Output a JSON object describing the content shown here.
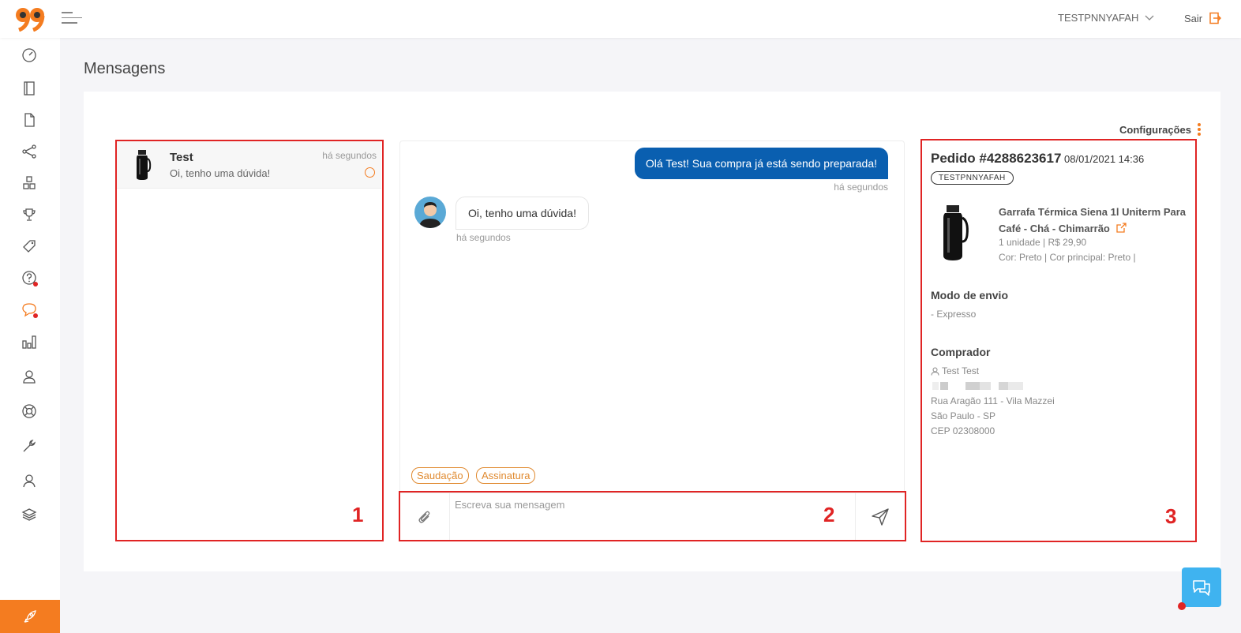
{
  "header": {
    "user_name": "TESTPNNYAFAH",
    "logout_label": "Sair"
  },
  "page": {
    "title": "Mensagens",
    "settings_label": "Configurações"
  },
  "conversations": [
    {
      "name": "Test",
      "last_message": "Oi, tenho uma dúvida!",
      "time": "há segundos"
    }
  ],
  "chat": {
    "outgoing_message": "Olá Test! Sua compra já está sendo preparada!",
    "outgoing_time": "há segundos",
    "incoming_message": "Oi, tenho uma dúvida!",
    "incoming_time": "há segundos",
    "quick_replies": [
      "Saudação",
      "Assinatura"
    ],
    "input_placeholder": "Escreva sua mensagem"
  },
  "order": {
    "title": "Pedido #4288623617",
    "date": "08/01/2021 14:36",
    "seller_badge": "TESTPNNYAFAH",
    "product_name": "Garrafa Térmica Siena 1l Uniterm Para Café - Chá - Chimarrão",
    "product_qty_price": "1 unidade | R$ 29,90",
    "product_attrs": "Cor: Preto | Cor principal: Preto |",
    "shipping_title": "Modo de envio",
    "shipping_value": "- Expresso",
    "buyer_title": "Comprador",
    "buyer_name": "Test Test",
    "buyer_address": "Rua Aragão 111 - Vila Mazzei",
    "buyer_city": "São Paulo - SP",
    "buyer_zip": "CEP 02308000"
  },
  "annotations": [
    "1",
    "2",
    "3"
  ],
  "colors": {
    "accent": "#f47c20",
    "primary_blue": "#0a5fb0",
    "annotation_red": "#e02424",
    "chat_fab": "#3fb3f0"
  },
  "icons": {
    "sidebar": [
      "dashboard-icon",
      "notebook-icon",
      "document-icon",
      "share-icon",
      "boxes-icon",
      "trophy-icon",
      "tag-icon",
      "help-icon",
      "chat-icon",
      "bar-chart-icon",
      "users-icon",
      "lifebuoy-icon",
      "wrench-icon",
      "user-icon",
      "layers-icon"
    ]
  }
}
